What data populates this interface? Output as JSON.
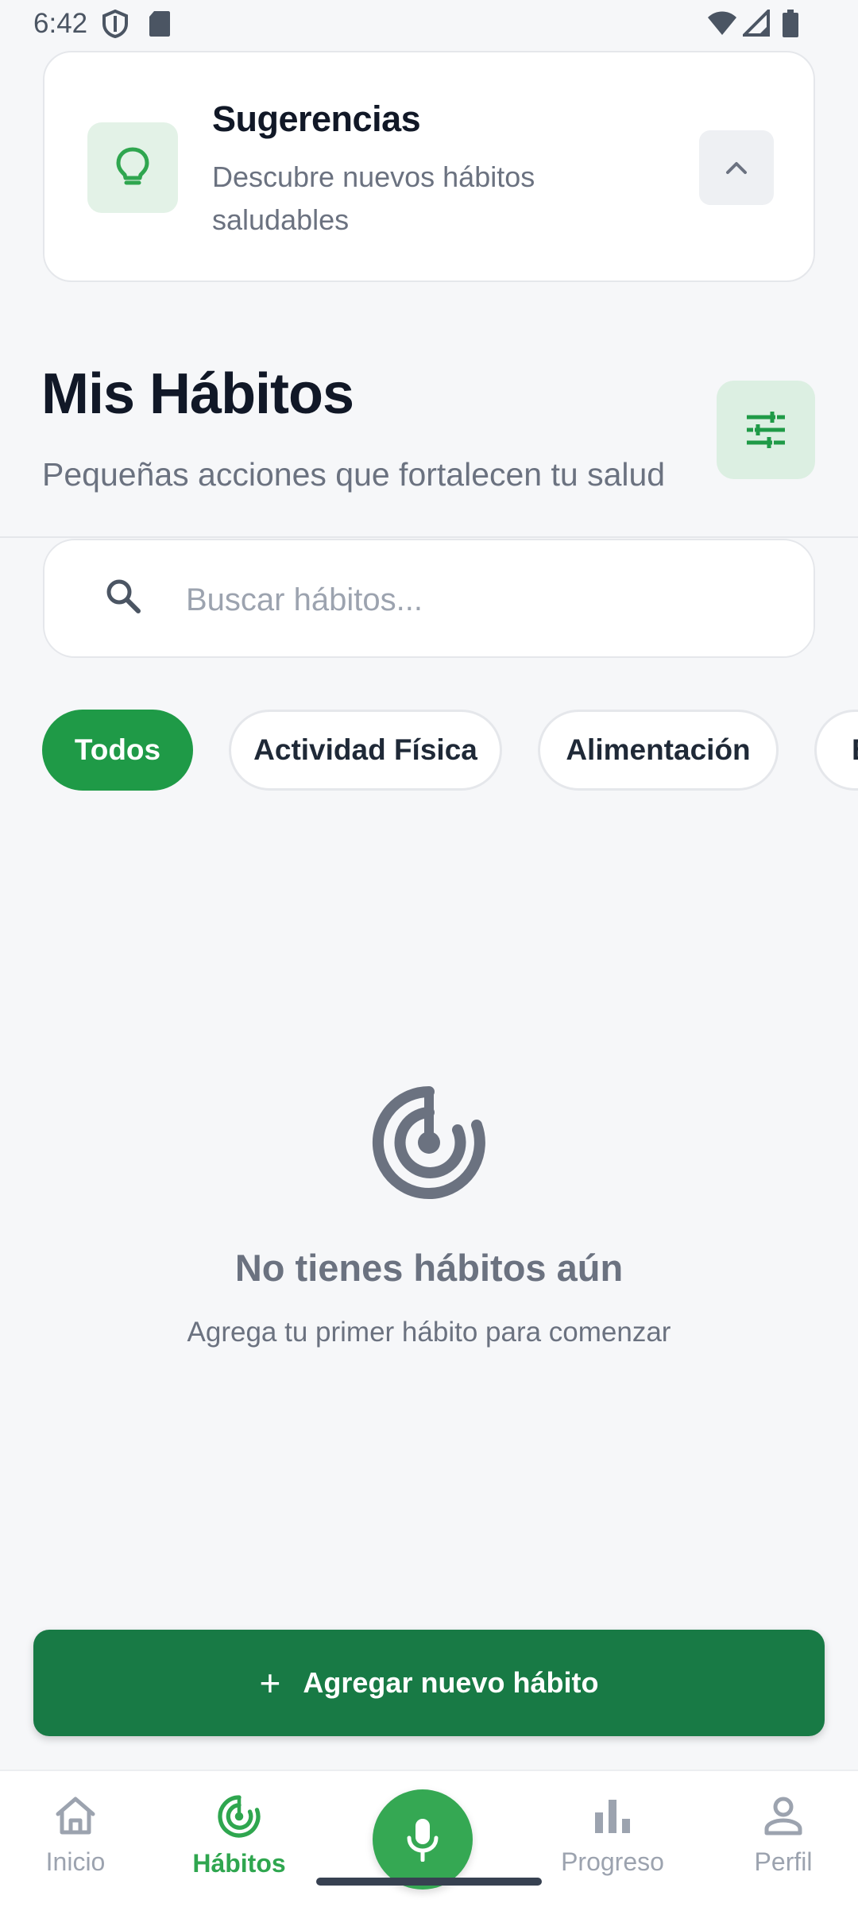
{
  "status_bar": {
    "time": "6:42"
  },
  "suggestions": {
    "title": "Sugerencias",
    "subtitle": "Descubre nuevos hábitos saludables",
    "icon": "lightbulb-icon"
  },
  "header": {
    "title": "Mis Hábitos",
    "subtitle": "Pequeñas acciones que fortalecen tu salud"
  },
  "search": {
    "placeholder": "Buscar hábitos...",
    "value": ""
  },
  "categories": {
    "items": [
      {
        "label": "Todos",
        "active": true
      },
      {
        "label": "Actividad Física",
        "active": false
      },
      {
        "label": "Alimentación",
        "active": false
      },
      {
        "label": "B",
        "active": false
      }
    ]
  },
  "empty_state": {
    "title": "No tienes hábitos aún",
    "subtitle": "Agrega tu primer hábito para comenzar",
    "icon": "target-icon"
  },
  "add_button": {
    "label": "Agregar nuevo hábito"
  },
  "bottom_nav": {
    "items": [
      {
        "label": "Inicio",
        "icon": "home-icon",
        "active": false
      },
      {
        "label": "Hábitos",
        "icon": "target-icon",
        "active": true
      },
      {
        "label": "Progreso",
        "icon": "bar-chart-icon",
        "active": false
      },
      {
        "label": "Perfil",
        "icon": "person-icon",
        "active": false
      }
    ],
    "center_action": {
      "icon": "microphone-icon"
    }
  },
  "colors": {
    "primary": "#1f9a47",
    "primary_dark": "#187a45",
    "accent_light": "#e3f2e7",
    "text_muted": "#6b7280",
    "background": "#f6f7f9"
  }
}
